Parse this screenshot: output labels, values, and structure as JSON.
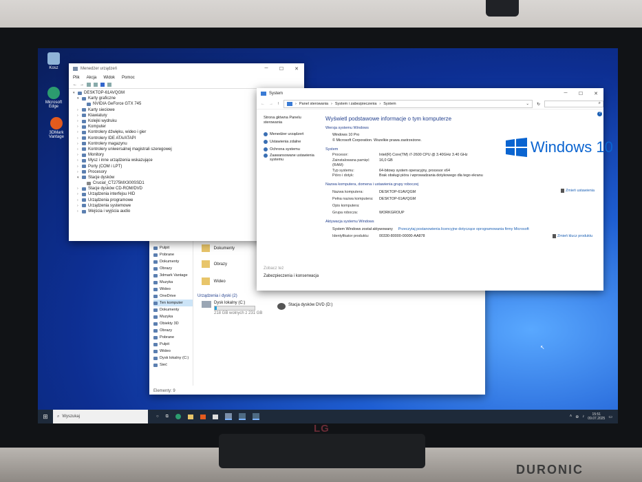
{
  "desktop": {
    "icons": [
      {
        "label": "Kosz",
        "color": "#8fb4d8"
      },
      {
        "label": "Microsoft Edge",
        "color": "#2c9c6f"
      },
      {
        "label": "3DMark Vantage",
        "color": "#e45b1e"
      }
    ]
  },
  "devmgr": {
    "title": "Menedżer urządzeń",
    "menu": [
      "Plik",
      "Akcja",
      "Widok",
      "Pomoc"
    ],
    "root": "DESKTOP-61AVQGM",
    "items": [
      "Karty graficzne",
      "NVIDIA GeForce GTX 745",
      "Karty sieciowe",
      "Klawiatury",
      "Kolejki wydruku",
      "Komputer",
      "Kontrolery dźwięku, wideo i gier",
      "Kontrolery IDE ATA/ATAPI",
      "Kontrolery magazynu",
      "Kontrolery uniwersalnej magistrali szeregowej",
      "Monitory",
      "Mysz i inne urządzenia wskazujące",
      "Porty (COM i LPT)",
      "Procesory",
      "Stacje dysków",
      "Crucial_CT275MX300SSD1",
      "Stacje dysków CD-ROM/DVD",
      "Urządzenia interfejsu HID",
      "Urządzenia programowe",
      "Urządzenia systemowe",
      "Wejścia i wyjścia audio"
    ]
  },
  "explorer": {
    "nav": [
      "Pulpit",
      "Pobrane",
      "Dokumenty",
      "Obrazy",
      "3dmark Vantage",
      "Muzyka",
      "Wideo",
      "OneDrive",
      "Ten komputer",
      "Dokumenty",
      "Muzyka",
      "Obiekty 3D",
      "Obrazy",
      "Pobrane",
      "Pulpit",
      "Wideo",
      "Dysk lokalny (C:)",
      "Sieć"
    ],
    "folders": [
      "Dokumenty",
      "Obrazy",
      "Wideo"
    ],
    "devices_header": "Urządzenia i dyski (2)",
    "drive_c_name": "Dysk lokalny (C:)",
    "drive_c_free": "218 GB wolnych z 231 GB",
    "drive_c_used_fraction": 0.06,
    "drive_d_name": "Stacja dysków DVD (D:)",
    "status": "Elementy: 9"
  },
  "system": {
    "title": "System",
    "breadcrumb": [
      "Panel sterowania",
      "System i zabezpieczenia",
      "System"
    ],
    "left_nav_home": "Strona główna Panelu sterowania",
    "left_links": [
      "Menedżer urządzeń",
      "Ustawienia zdalne",
      "Ochrona systemu",
      "Zaawansowane ustawienia systemu"
    ],
    "see_also": "Zobacz też",
    "see_also_link": "Zabezpieczenia i konserwacja",
    "heading": "Wyświetl podstawowe informacje o tym komputerze",
    "edition_header": "Wersja systemu Windows",
    "edition": "Windows 10 Pro",
    "copyright": "© Microsoft Corporation. Wszelkie prawa zastrzeżone.",
    "logo_text": "Windows 10",
    "system_header": "System",
    "processor_k": "Procesor:",
    "processor_v": "Intel(R) Core(TM) i7-2600 CPU @ 3.40GHz   3.40 GHz",
    "ram_k": "Zainstalowana pamięć (RAM):",
    "ram_v": "16,0 GB",
    "type_k": "Typ systemu:",
    "type_v": "64-bitowy system operacyjny, procesor x64",
    "pen_k": "Pióro i dotyk:",
    "pen_v": "Brak obsługi pióra i wprowadzania dotykowego dla tego ekranu",
    "name_header": "Nazwa komputera, domena i ustawienia grupy roboczej",
    "cname_k": "Nazwa komputera:",
    "cname_v": "DESKTOP-61AVQGM",
    "fname_k": "Pełna nazwa komputera:",
    "fname_v": "DESKTOP-61AVQGM",
    "desc_k": "Opis komputera:",
    "group_k": "Grupa robocza:",
    "group_v": "WORKGROUP",
    "change_settings": "Zmień ustawienia",
    "activation_header": "Aktywacja systemu Windows",
    "activated": "System Windows został aktywowany",
    "license_link": "Przeczytaj postanowienia licencyjne dotyczące oprogramowania firmy Microsoft",
    "pid_k": "Identyfikator produktu:",
    "pid_v": "00330-80000-00000-AA878",
    "change_key": "Zmień klucz produktu"
  },
  "taskbar": {
    "search_placeholder": "Wyszukaj",
    "time": "15:51",
    "date": "09.07.2025"
  },
  "monitor": {
    "logo": "LG",
    "stand_brand": "DURONIC"
  },
  "colors": {
    "accent": "#0a64d0",
    "link": "#1a5fb4",
    "heading": "#23408e"
  }
}
